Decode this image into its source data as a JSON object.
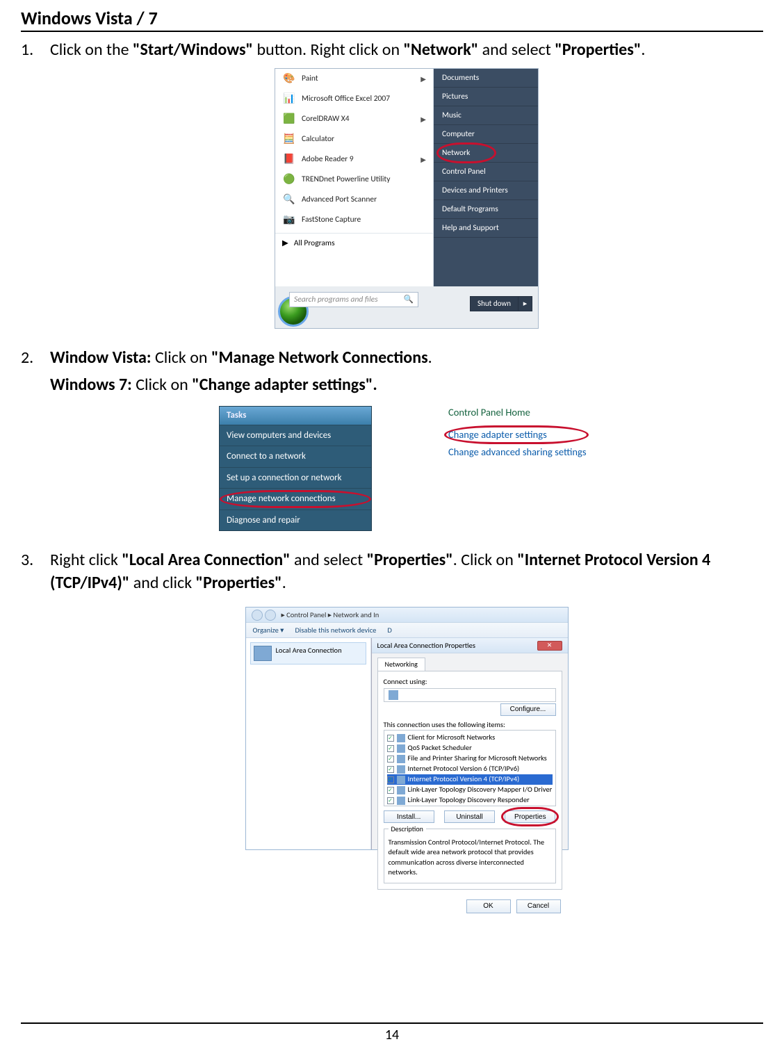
{
  "heading": "Windows Vista / 7",
  "step1": {
    "pre": "Click on the ",
    "b1": "\"Start/Windows\"",
    "mid1": " button. Right click on ",
    "b2": "\"Network\"",
    "mid2": " and select ",
    "b3": "\"Properties\"",
    "post": "."
  },
  "startmenu": {
    "left": [
      {
        "icon": "🎨",
        "label": "Paint",
        "submenu": true
      },
      {
        "icon": "📊",
        "label": "Microsoft Office Excel 2007",
        "submenu": false
      },
      {
        "icon": "🟩",
        "label": "CorelDRAW X4",
        "submenu": true
      },
      {
        "icon": "🧮",
        "label": "Calculator",
        "submenu": false
      },
      {
        "icon": "📕",
        "label": "Adobe Reader 9",
        "submenu": true
      },
      {
        "icon": "🟢",
        "label": "TRENDnet Powerline Utility",
        "submenu": false
      },
      {
        "icon": "🔍",
        "label": "Advanced Port Scanner",
        "submenu": false
      },
      {
        "icon": "📷",
        "label": "FastStone Capture",
        "submenu": false
      }
    ],
    "allprograms": "All Programs",
    "search_placeholder": "Search programs and files",
    "right": [
      "Documents",
      "Pictures",
      "Music",
      "Computer",
      "Network",
      "Control Panel",
      "Devices and Printers",
      "Default Programs",
      "Help and Support"
    ],
    "right_highlight_index": 4,
    "shutdown": "Shut down"
  },
  "step2": {
    "l1_b1": "Window Vista:",
    "l1_t1": " Click on ",
    "l1_b2": "\"Manage Network Connections",
    "l1_t2": ".",
    "l2_b1": "Windows 7:",
    "l2_t1": " Click on ",
    "l2_b2": "\"Change adapter settings\"."
  },
  "tasks_panel": {
    "header": "Tasks",
    "rows": [
      "View computers and devices",
      "Connect to a network",
      "Set up a connection or network",
      "Manage network connections",
      "Diagnose and repair"
    ],
    "highlight_index": 3
  },
  "cp_home": {
    "title": "Control Panel Home",
    "links": [
      "Change adapter settings",
      "Change advanced sharing settings"
    ],
    "highlight_index": 0
  },
  "step3": {
    "pre": "Right click ",
    "b1": "\"Local Area Connection\"",
    "mid1": " and select ",
    "b2": "\"Properties\"",
    "mid2": ". Click on ",
    "b3": "\"Internet Protocol Version 4 (TCP/IPv4)\"",
    "mid3": " and click ",
    "b4": "\"Properties\"",
    "post": "."
  },
  "explorer": {
    "breadcrumb": "▸ Control Panel ▸ Network and In",
    "organize": "Organize ▾",
    "disable": "Disable this network device",
    "lac": "Local Area Connection"
  },
  "dialog": {
    "title": "Local Area Connection Properties",
    "tab": "Networking",
    "connect_using": "Connect using:",
    "configure": "Configure...",
    "uses_label": "This connection uses the following items:",
    "items": [
      "Client for Microsoft Networks",
      "QoS Packet Scheduler",
      "File and Printer Sharing for Microsoft Networks",
      "Internet Protocol Version 6 (TCP/IPv6)",
      "Internet Protocol Version 4 (TCP/IPv4)",
      "Link-Layer Topology Discovery Mapper I/O Driver",
      "Link-Layer Topology Discovery Responder"
    ],
    "selected_index": 4,
    "install": "Install...",
    "uninstall": "Uninstall",
    "properties": "Properties",
    "desc_label": "Description",
    "desc_text": "Transmission Control Protocol/Internet Protocol. The default wide area network protocol that provides communication across diverse interconnected networks.",
    "ok": "OK",
    "cancel": "Cancel"
  },
  "page_number": "14"
}
